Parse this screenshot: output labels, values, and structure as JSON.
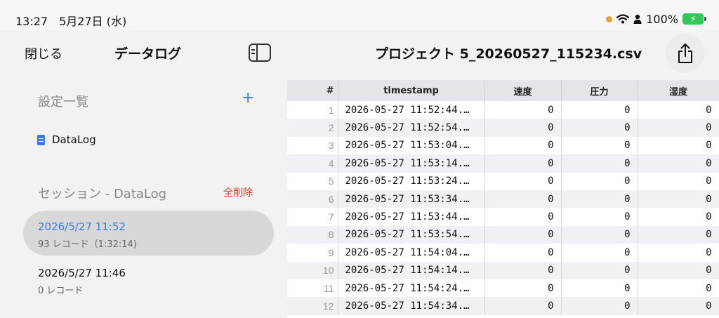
{
  "status": {
    "time": "13:27　5月27日 (水)",
    "battery_percent": "100%",
    "dot_color": "#f0a030",
    "battery_color": "#34c759"
  },
  "sidebar": {
    "close_label": "閉じる",
    "title": "データログ",
    "toggle_icon": "sidebar-toggle-icon",
    "config_header": "設定一覧",
    "add_label": "+",
    "config_items": [
      {
        "label": "DataLog",
        "icon": "document-icon"
      }
    ],
    "session_header": "セッション - DataLog",
    "delete_all_label": "全削除",
    "sessions": [
      {
        "date": "2026/5/27 11:52",
        "meta": "93 レコード（1:32:14)",
        "selected": true
      },
      {
        "date": "2026/5/27 11:46",
        "meta": "0 レコード",
        "selected": false
      }
    ]
  },
  "header": {
    "file_title": "プロジェクト 5_20260527_115234.csv",
    "share_icon": "share-icon"
  },
  "table": {
    "columns": [
      "#",
      "timestamp",
      "速度",
      "圧力",
      "湿度"
    ],
    "rows": [
      [
        "1",
        "2026-05-27 11:52:44.…",
        "0",
        "0",
        "0"
      ],
      [
        "2",
        "2026-05-27 11:52:54.…",
        "0",
        "0",
        "0"
      ],
      [
        "3",
        "2026-05-27 11:53:04.…",
        "0",
        "0",
        "0"
      ],
      [
        "4",
        "2026-05-27 11:53:14.…",
        "0",
        "0",
        "0"
      ],
      [
        "5",
        "2026-05-27 11:53:24.…",
        "0",
        "0",
        "0"
      ],
      [
        "6",
        "2026-05-27 11:53:34.…",
        "0",
        "0",
        "0"
      ],
      [
        "7",
        "2026-05-27 11:53:44.…",
        "0",
        "0",
        "0"
      ],
      [
        "8",
        "2026-05-27 11:53:54.…",
        "0",
        "0",
        "0"
      ],
      [
        "9",
        "2026-05-27 11:54:04.…",
        "0",
        "0",
        "0"
      ],
      [
        "10",
        "2026-05-27 11:54:14.…",
        "0",
        "0",
        "0"
      ],
      [
        "11",
        "2026-05-27 11:54:24.…",
        "0",
        "0",
        "0"
      ],
      [
        "12",
        "2026-05-27 11:54:34.…",
        "0",
        "0",
        "0"
      ]
    ]
  }
}
